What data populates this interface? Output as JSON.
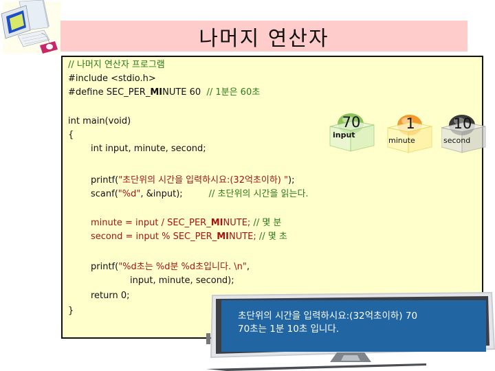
{
  "slide": {
    "title": "나머지 연산자"
  },
  "code": {
    "line1_comment": "// 나머지 연산자 프로그램",
    "line2": "#include <stdio.h>",
    "line3_code": "#define SEC_PER_",
    "line3_bold": "MI",
    "line3_rest": "NUTE 60  ",
    "line3_comment": "// 1분은 60초",
    "line4": "int main(void)",
    "line5": "{",
    "line6": "int input, minute, second;",
    "line7_prefix": "printf(",
    "line7_str": "\"초단위의 시간을 입력하시요:(32억초이하) \"",
    "line7_suffix": ");",
    "line8_prefix": "scanf(",
    "line8_str": "\"%d\"",
    "line8_suffix": ", &input);",
    "line8_comment": "// 초단위의 시간을 읽는다.",
    "line9_expr": "minute = input / SEC_PER_",
    "line9_bold": "MI",
    "line9_rest": "NUTE; ",
    "line9_comment": "// 몇 분",
    "line10_expr": "second = input % SEC_PER_",
    "line10_bold": "MI",
    "line10_rest": "NUTE; ",
    "line10_comment": "// 몇 초",
    "line11_prefix": "printf(",
    "line11_str": "\"%d초는 %d분 %d초입니다. \\n\"",
    "line11_suffix": ",",
    "line12": "input, minute, second);",
    "line13": "return 0;",
    "line14": "}"
  },
  "variables": [
    {
      "name": "input",
      "value": "70",
      "color": "#9ccc6a"
    },
    {
      "name": "minute",
      "value": "1",
      "color": "#f0a030"
    },
    {
      "name": "second",
      "value": "10",
      "color": "#444444"
    }
  ],
  "console": {
    "line1": "초단위의 시간을 입력하시요:(32억초이하) 70",
    "line2": "70초는 1분 10초 입니다.",
    "screen_color": "#2166a3"
  }
}
